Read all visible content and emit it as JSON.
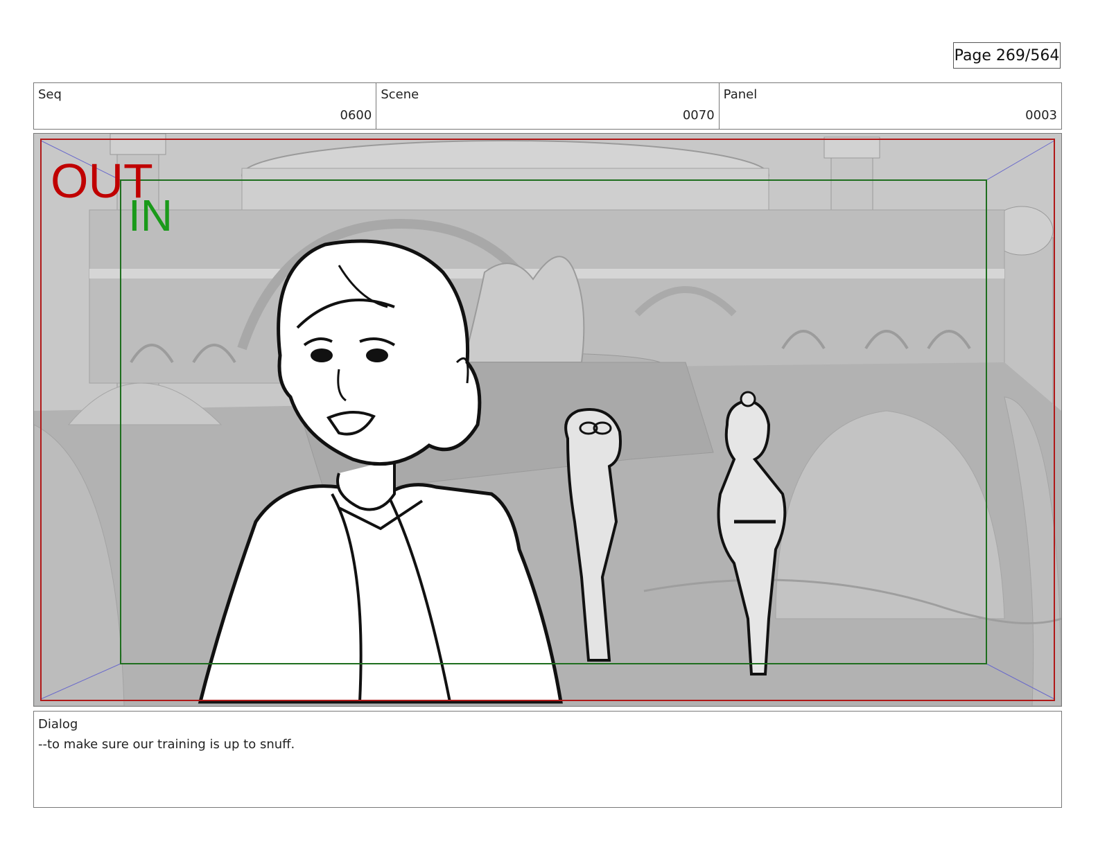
{
  "page": {
    "label": "Page 269/564"
  },
  "header": {
    "seq": {
      "label": "Seq",
      "value": "0600"
    },
    "scene": {
      "label": "Scene",
      "value": "0070"
    },
    "panel": {
      "label": "Panel",
      "value": "0003"
    }
  },
  "frame": {
    "out_label": "OUT",
    "in_label": "IN",
    "colors": {
      "out": "#c00000",
      "in": "#1a9a1a",
      "safe_line": "#1e6e1e",
      "out_line": "#b01818"
    }
  },
  "dialog": {
    "label": "Dialog",
    "text": "--to make sure our training is up to snuff."
  }
}
